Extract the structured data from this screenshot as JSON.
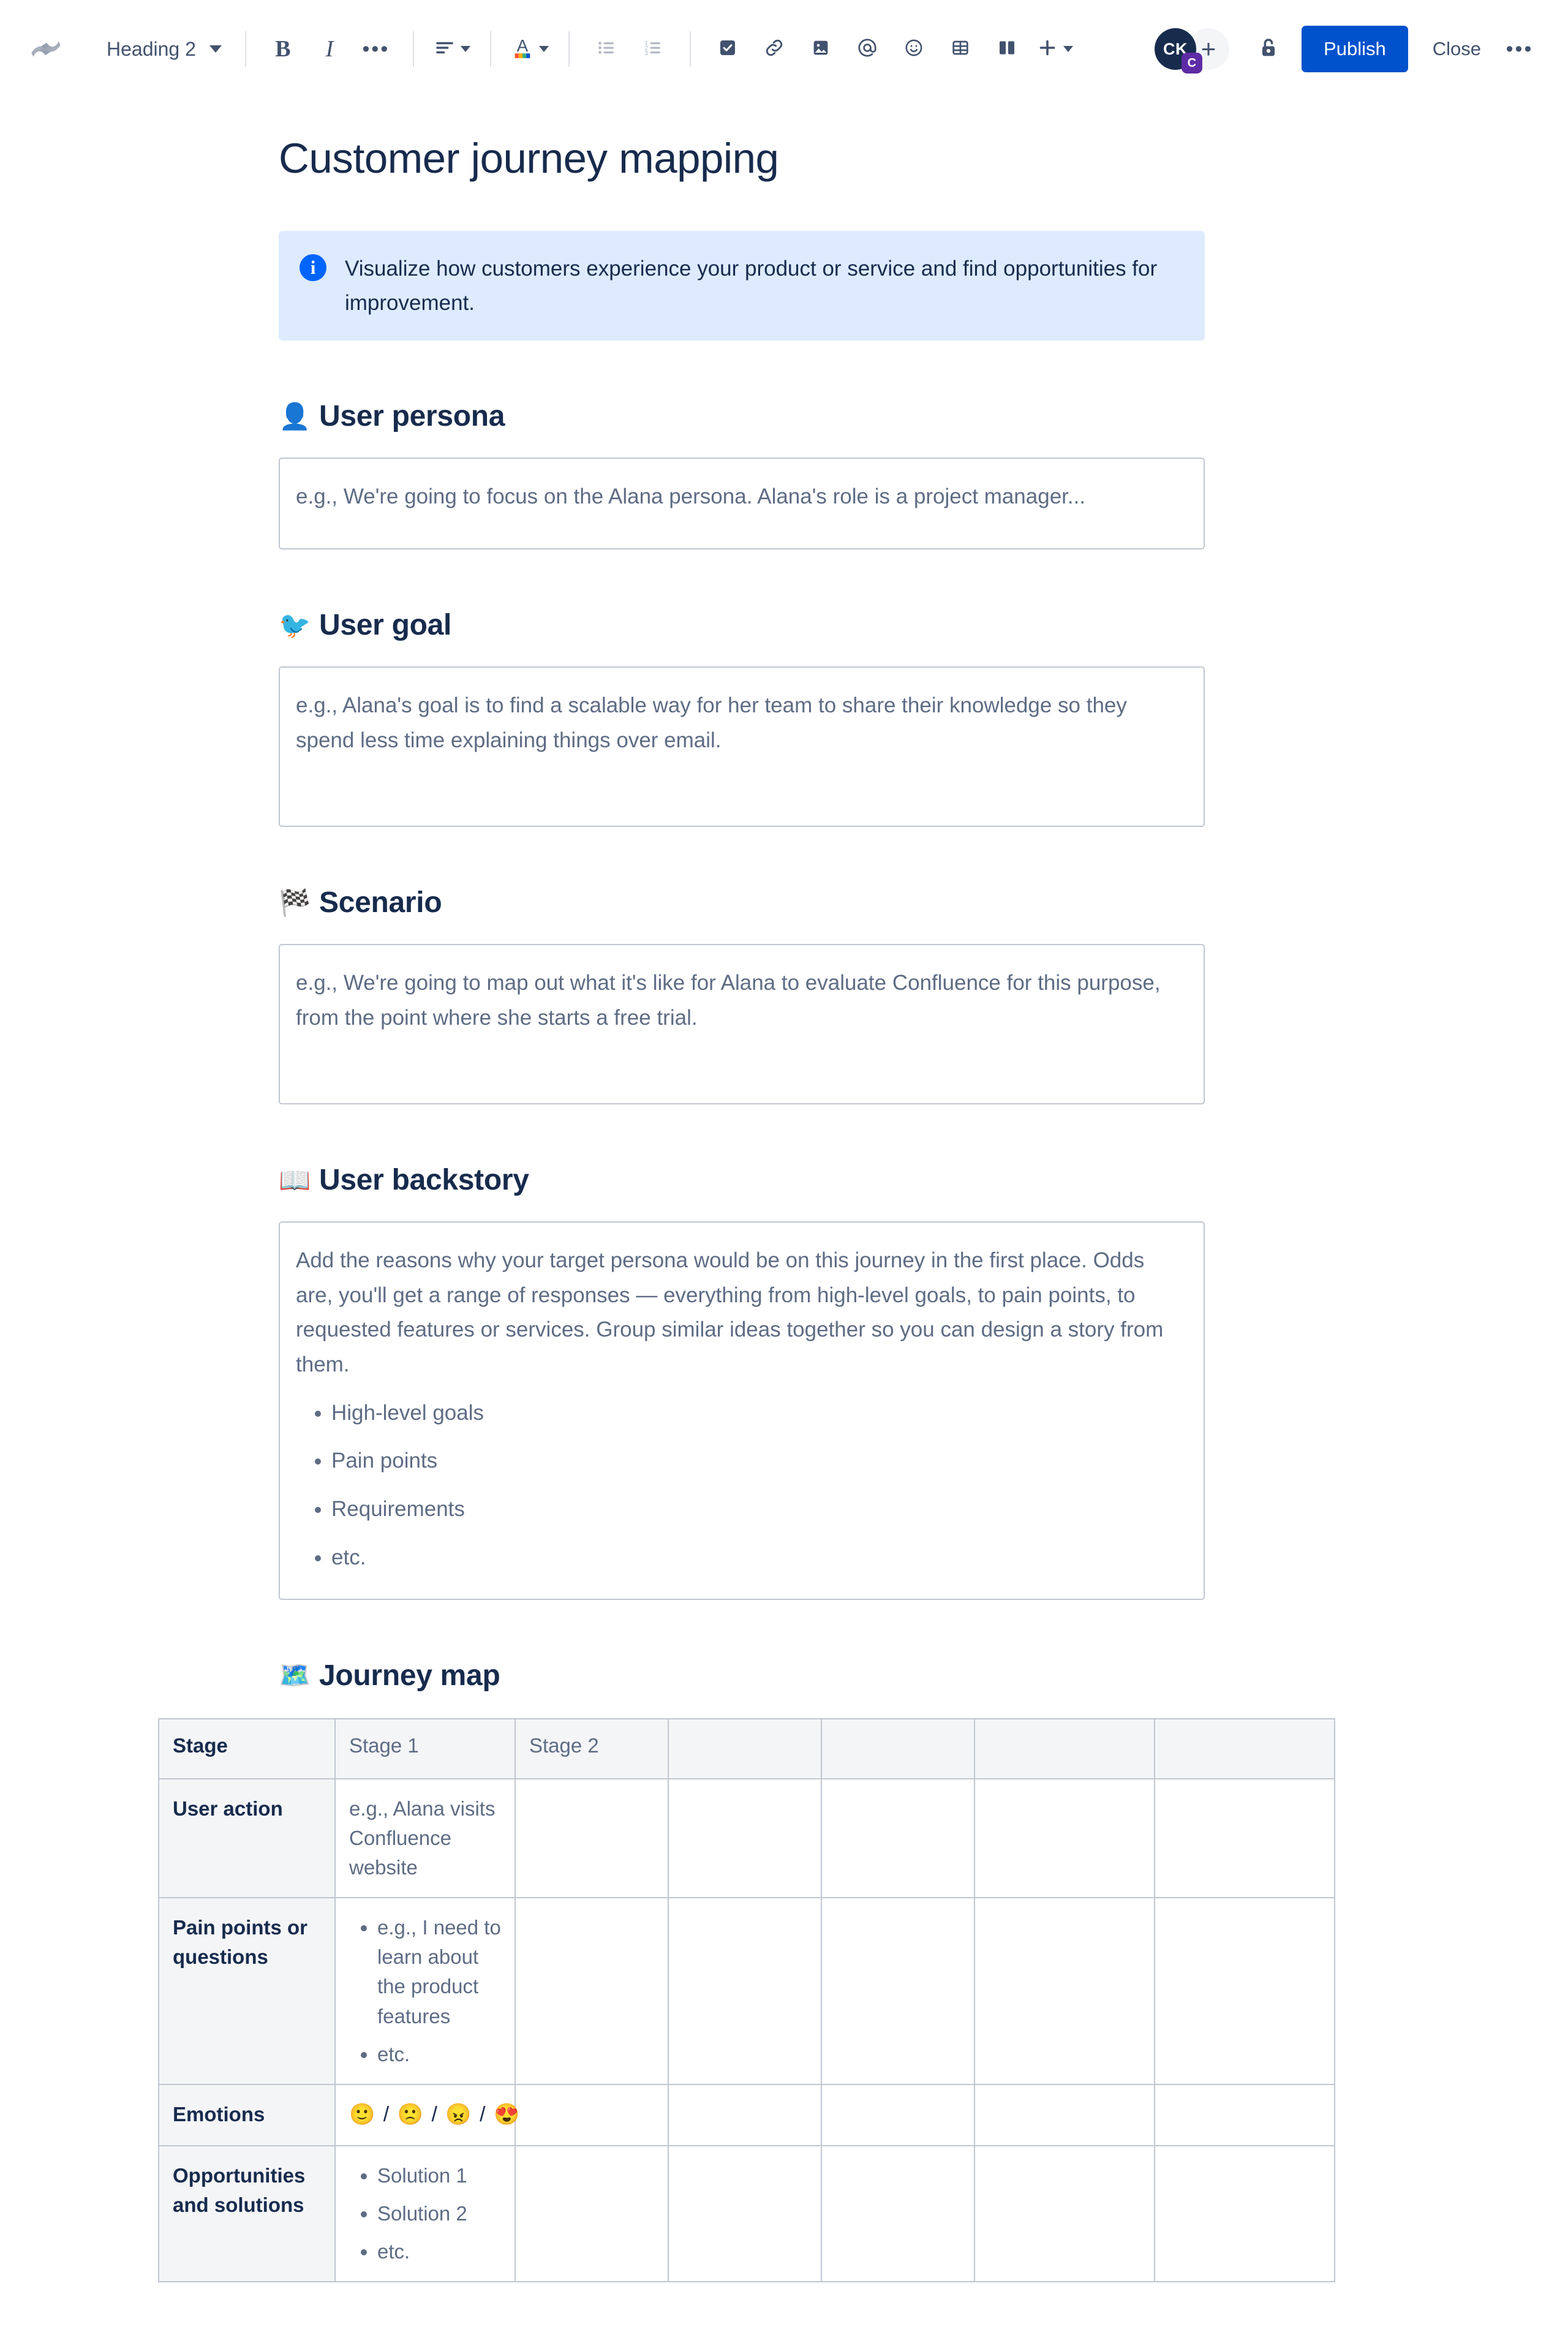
{
  "toolbar": {
    "logo_icon": "confluence-logo-icon",
    "style_label": "Heading 2",
    "bold_label": "B",
    "italic_label": "I",
    "more_formatting_label": "•••",
    "align_icon": "text-align-icon",
    "text_color_icon": "text-color-icon",
    "bullet_list_icon": "bullet-list-icon",
    "numbered_list_icon": "numbered-list-icon",
    "task_icon": "task-checkbox-icon",
    "link_icon": "link-icon",
    "image_icon": "image-icon",
    "mention_icon": "mention-at-icon",
    "emoji_icon": "emoji-icon",
    "table_icon": "table-icon",
    "layout_icon": "layout-columns-icon",
    "insert_label": "+",
    "avatar_initials": "CK",
    "avatar_badge": "C",
    "add_person_label": "+",
    "lock_icon": "unlock-icon",
    "publish_label": "Publish",
    "close_label": "Close",
    "more_options_label": "•••",
    "accent_color": "#0052CC",
    "avatar_color": "#172B4D",
    "badge_color": "#5E2CA5"
  },
  "page": {
    "title": "Customer journey mapping",
    "info_panel": {
      "icon": "info-icon",
      "text": "Visualize how customers experience your product or service and find opportunities for improvement.",
      "background": "#DEEBFF",
      "icon_color": "#0065FF"
    },
    "sections": [
      {
        "emoji": "👤",
        "emoji_name": "bust-in-silhouette-emoji",
        "heading": "User persona",
        "placeholder": "e.g., We're going to focus on the Alana persona. Alana's role is a project manager..."
      },
      {
        "emoji": "🐦",
        "emoji_name": "bird-emoji",
        "heading": "User goal",
        "placeholder": "e.g., Alana's goal is to find a scalable way for her team to share their knowledge so they spend less time explaining things over email."
      },
      {
        "emoji": "🏁",
        "emoji_name": "chequered-flag-emoji",
        "heading": "Scenario",
        "placeholder": "e.g., We're going to map out what it's like for Alana to evaluate Confluence for this purpose, from the point where she starts a free trial."
      },
      {
        "emoji": "📖",
        "emoji_name": "open-book-emoji",
        "heading": "User backstory",
        "placeholder": "Add the reasons why your target persona would be on this journey in the first place. Odds are, you'll get a range of responses — everything from high-level goals, to pain points, to requested features or services. Group similar ideas together so you can design a story from them.",
        "bullets": [
          "High-level goals",
          "Pain points",
          "Requirements",
          "etc."
        ]
      }
    ],
    "journey_map": {
      "emoji": "🗺️",
      "emoji_name": "world-map-emoji",
      "heading": "Journey map",
      "headers": [
        "Stage",
        "Stage 1",
        "Stage 2",
        "",
        "",
        "",
        ""
      ],
      "rows": [
        {
          "label": "User action",
          "cells": [
            {
              "type": "text",
              "text": "e.g., Alana visits Confluence website"
            },
            {
              "type": "empty"
            },
            {
              "type": "empty"
            },
            {
              "type": "empty"
            },
            {
              "type": "empty"
            },
            {
              "type": "empty"
            }
          ]
        },
        {
          "label": "Pain points or questions",
          "cells": [
            {
              "type": "list",
              "items": [
                "e.g., I need to learn about the product features",
                "etc."
              ]
            },
            {
              "type": "empty"
            },
            {
              "type": "empty"
            },
            {
              "type": "empty"
            },
            {
              "type": "empty"
            },
            {
              "type": "empty"
            }
          ]
        },
        {
          "label": "Emotions",
          "cells": [
            {
              "type": "emoji",
              "text": "🙂 / 🙁 / 😠 / 😍"
            },
            {
              "type": "empty"
            },
            {
              "type": "empty"
            },
            {
              "type": "empty"
            },
            {
              "type": "empty"
            },
            {
              "type": "empty"
            }
          ]
        },
        {
          "label": "Opportunities and solutions",
          "cells": [
            {
              "type": "list",
              "items": [
                "Solution 1",
                "Solution 2",
                "etc."
              ]
            },
            {
              "type": "empty"
            },
            {
              "type": "empty"
            },
            {
              "type": "empty"
            },
            {
              "type": "empty"
            },
            {
              "type": "empty"
            }
          ]
        }
      ]
    }
  }
}
